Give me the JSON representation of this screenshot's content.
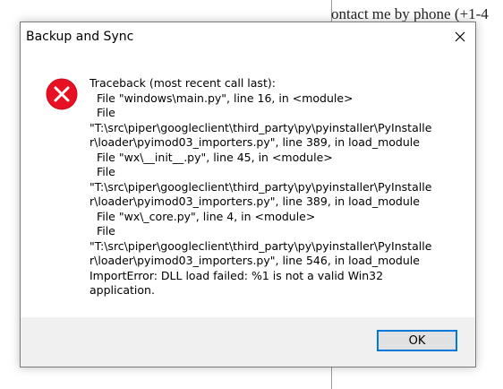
{
  "background_document": {
    "text": "ontact me by phone (+1-4"
  },
  "dialog": {
    "title": "Backup and Sync",
    "close_icon": "close-icon",
    "error_icon": "error-icon",
    "error_color": "#e81123",
    "message": "Traceback (most recent call last):\n  File \"windows\\main.py\", line 16, in <module>\n  File\n\"T:\\src\\piper\\googleclient\\third_party\\py\\pyinstaller\\PyInstalle\nr\\loader\\pyimod03_importers.py\", line 389, in load_module\n  File \"wx\\__init__.py\", line 45, in <module>\n  File\n\"T:\\src\\piper\\googleclient\\third_party\\py\\pyinstaller\\PyInstalle\nr\\loader\\pyimod03_importers.py\", line 389, in load_module\n  File \"wx\\_core.py\", line 4, in <module>\n  File\n\"T:\\src\\piper\\googleclient\\third_party\\py\\pyinstaller\\PyInstalle\nr\\loader\\pyimod03_importers.py\", line 546, in load_module\nImportError: DLL load failed: %1 is not a valid Win32\napplication.",
    "ok_label": "OK",
    "accent_color": "#0078d7"
  }
}
